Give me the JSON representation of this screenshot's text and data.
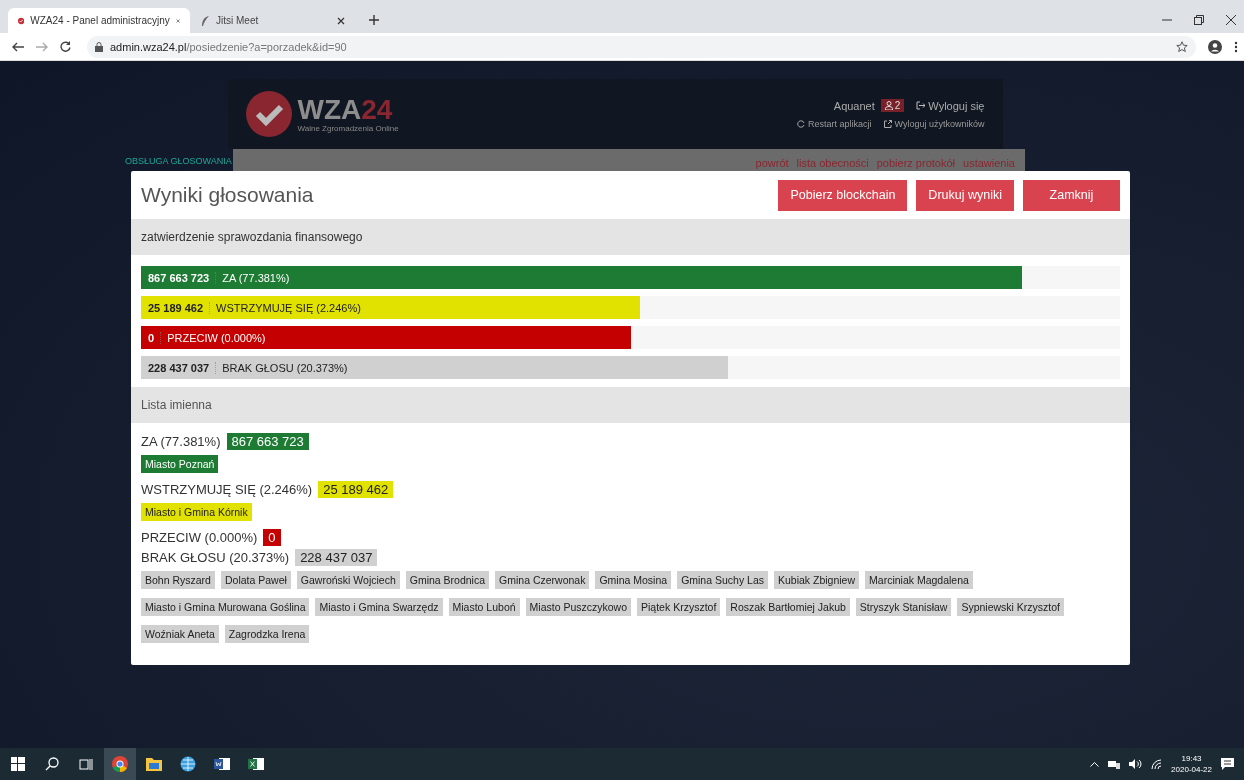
{
  "browser": {
    "tabs": [
      {
        "title": "WZA24 - Panel administracyjny",
        "selected": true,
        "kind": "app"
      },
      {
        "title": "Jitsi Meet",
        "selected": false,
        "kind": "feather"
      }
    ],
    "address": {
      "host": "admin.wza24.pl",
      "path": "/posiedzenie?a=porzadek&id=90"
    }
  },
  "app_header": {
    "logo": {
      "text": "WZA",
      "accent": "24",
      "subtitle": "Walne Zgromadzenia Online"
    },
    "user": "Aquanet",
    "user_badge": "2",
    "logout": "Wyloguj się",
    "restart": "Restart aplikacji",
    "logout_users": "Wyloguj użytkowników"
  },
  "section_label": "OBSŁUGA GŁOSOWANIA",
  "nav_links": [
    "powrót",
    "lista obecności",
    "pobierz protokół",
    "ustawienia"
  ],
  "modal": {
    "title": "Wyniki głosowania",
    "buttons": [
      "Pobierz blockchain",
      "Drukuj wyniki",
      "Zamknij"
    ],
    "question": "zatwierdzenie sprawozdania finansowego",
    "results": [
      {
        "count": "867 663 723",
        "label": "ZA (77.381%)",
        "level": 0.9,
        "color": "#1e7b34"
      },
      {
        "count": "25 189 462",
        "label": "WSTRZYMUJĘ SIĘ (2.246%)",
        "level": 0.51,
        "color": "#e2e200"
      },
      {
        "count": "0",
        "label": "PRZECIW (0.000%)",
        "level": 0.5,
        "color": "#c40000"
      },
      {
        "count": "228 437 037",
        "label": "BRAK GŁOSU (20.373%)",
        "level": 0.6,
        "color": "#d0d0d0"
      }
    ],
    "list_title": "Lista imienna",
    "groups": [
      {
        "label": "ZA (77.381%)",
        "count": "867 663 723",
        "color": "#1e7b34",
        "names": [
          "Miasto Poznań"
        ]
      },
      {
        "label": "WSTRZYMUJĘ SIĘ (2.246%)",
        "count": "25 189 462",
        "color": "#e2e200",
        "names": [
          "Miasto i Gmina Kórnik"
        ]
      },
      {
        "label": "PRZECIW (0.000%)",
        "count": "0",
        "color": "#c40000"
      },
      {
        "label": "BRAK GŁOSU (20.373%)",
        "count": "228 437 037",
        "color": "#d0d0d0",
        "names": [
          "Bohn Ryszard",
          "Dolata Paweł",
          "Gawroński Wojciech",
          "Gmina Brodnica",
          "Gmina Czerwonak",
          "Gmina Mosina",
          "Gmina Suchy Las",
          "Kubiak Zbigniew",
          "Marciniak Magdalena",
          "Miasto i Gmina Murowana Goślina",
          "Miasto i Gmina Swarzędz",
          "Miasto Luboń",
          "Miasto Puszczykowo",
          "Piątek Krzysztof",
          "Roszak Bartłomiej Jakub",
          "Stryszyk Stanisław",
          "Sypniewski Krzysztof",
          "Woźniak Aneta",
          "Zagrodzka Irena"
        ]
      }
    ]
  },
  "taskbar": {
    "apps": [
      {
        "kind": "windows"
      },
      {
        "kind": "search"
      },
      {
        "kind": "taskview"
      },
      {
        "kind": "chrome",
        "selected": true
      },
      {
        "kind": "folder",
        "selected": false
      },
      {
        "kind": "globe",
        "selected": false
      },
      {
        "kind": "word",
        "selected": false
      },
      {
        "kind": "excel",
        "selected": false
      }
    ],
    "time": "19:43",
    "date": "2020-04-22"
  }
}
